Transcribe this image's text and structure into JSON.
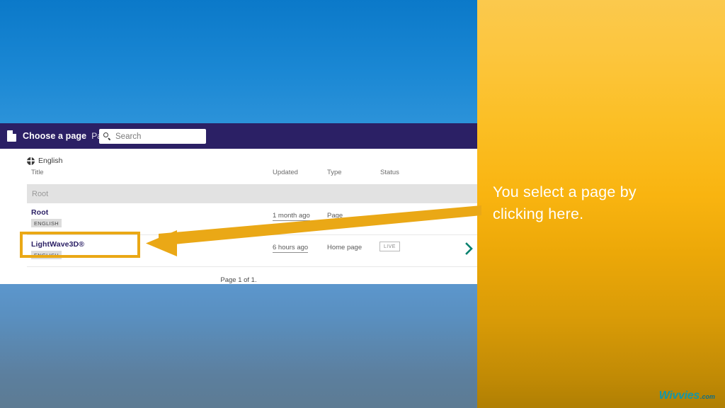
{
  "slide": {
    "background_blue": "#2b8ed6",
    "background_orange": "#f9b410"
  },
  "app": {
    "header": {
      "doc_icon": "document-icon",
      "title": "Choose a page",
      "subtitle": "Page",
      "search": {
        "icon": "search-icon",
        "placeholder": "Search",
        "value": ""
      }
    },
    "language": {
      "icon": "globe-icon",
      "label": "English"
    },
    "columns": {
      "title": "Title",
      "updated": "Updated",
      "type": "Type",
      "status": "Status"
    },
    "breadcrumb": {
      "label": "Root"
    },
    "rows": [
      {
        "title": "Root",
        "language_badge": "ENGLISH",
        "updated": "1 month ago",
        "type": "Page",
        "status": "",
        "chevron": ""
      },
      {
        "title": "LightWave3D®",
        "language_badge": "ENGLISH",
        "updated": "6 hours ago",
        "type": "Home page",
        "status": "LIVE",
        "chevron": "chevron-right-icon"
      }
    ],
    "pager": "Page 1 of 1."
  },
  "annotation": {
    "line1": "You select a page by",
    "line2": "clicking here.",
    "arrow_color": "#eaa816",
    "highlight_color": "#eaa816"
  },
  "watermark": {
    "name": "Wivvies",
    "tld": ".com",
    "color": "#1696a8"
  }
}
